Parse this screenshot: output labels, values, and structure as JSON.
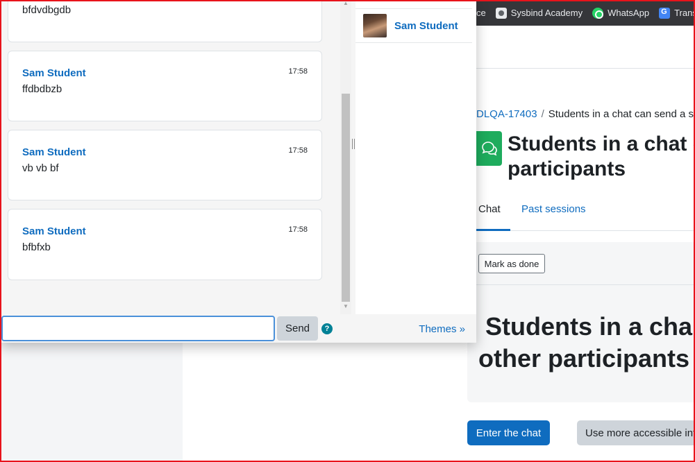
{
  "browser": {
    "bookmarks": [
      {
        "label": "ce",
        "icon": "partial-icon"
      },
      {
        "label": "Sysbind Academy",
        "icon": "sysbind-icon"
      },
      {
        "label": "WhatsApp",
        "icon": "whatsapp-icon"
      },
      {
        "label": "Transla",
        "icon": "google-translate-icon"
      }
    ]
  },
  "chat": {
    "messages": [
      {
        "user": "",
        "time": "",
        "text": "bfdvdbgdb"
      },
      {
        "user": "Sam Student",
        "time": "17:58",
        "text": "ffdbdbzb"
      },
      {
        "user": "Sam Student",
        "time": "17:58",
        "text": "vb vb bf"
      },
      {
        "user": "Sam Student",
        "time": "17:58",
        "text": "bfbfxb"
      }
    ],
    "users": [
      {
        "name": "Sam Student"
      }
    ],
    "input": {
      "value": "",
      "placeholder": ""
    },
    "send_label": "Send",
    "help_label": "?",
    "themes_label": "Themes »"
  },
  "page": {
    "breadcrumb": {
      "course": "DLQA-17403",
      "separator": "/",
      "current": "Students in a chat can send a so"
    },
    "title_line1": "Students in a chat c",
    "title_line2": "participants",
    "tabs": [
      {
        "label": "Chat",
        "active": true
      },
      {
        "label": "Past sessions",
        "active": false
      }
    ],
    "mark_done_label": "Mark as done",
    "intro_line1": "Students in a cha",
    "intro_line2": "other participants",
    "enter_chat_label": "Enter the chat",
    "accessible_label": "Use more accessible int"
  },
  "colors": {
    "link": "#0f6cbf",
    "activity_icon": "#1eac5d",
    "help_icon": "#008196",
    "frame_border": "#e8131b"
  }
}
